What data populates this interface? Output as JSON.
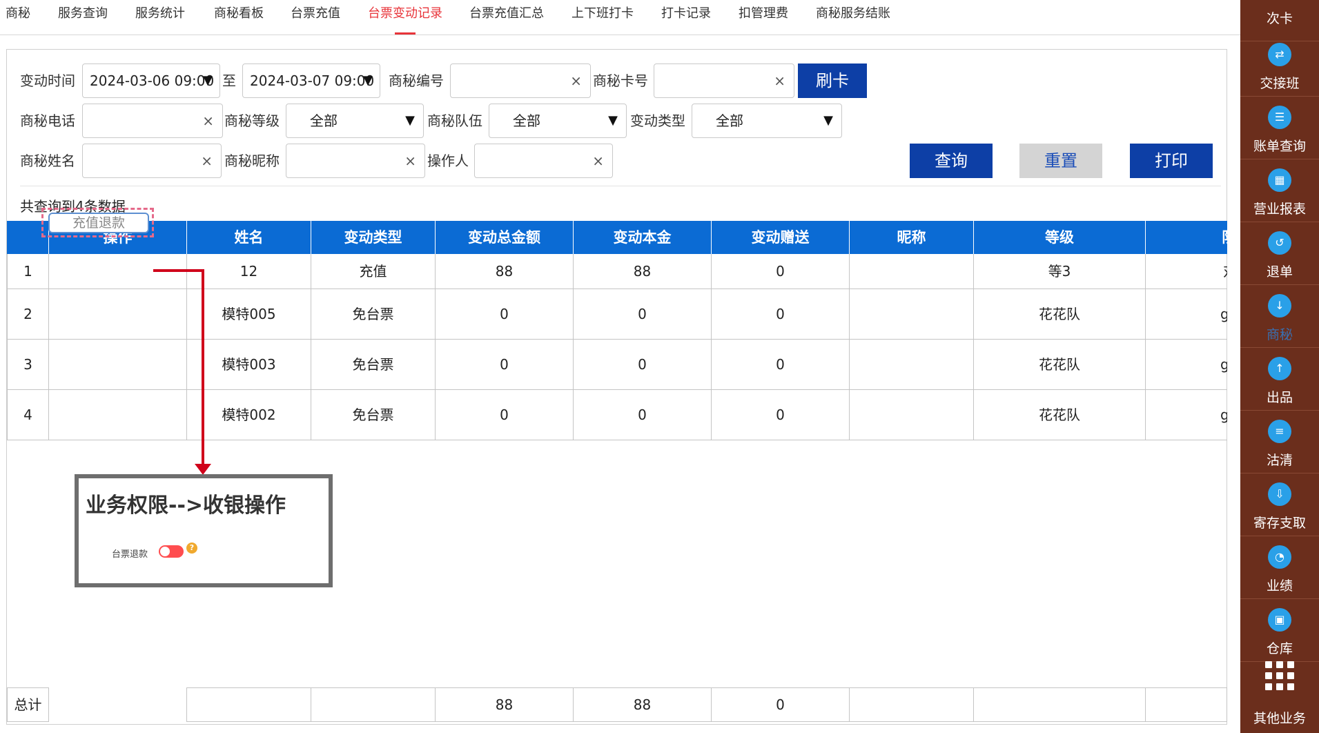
{
  "tabs": [
    {
      "label": "商秘",
      "active": false
    },
    {
      "label": "服务查询",
      "active": false
    },
    {
      "label": "服务统计",
      "active": false
    },
    {
      "label": "商秘看板",
      "active": false
    },
    {
      "label": "台票充值",
      "active": false
    },
    {
      "label": "台票变动记录",
      "active": true
    },
    {
      "label": "台票充值汇总",
      "active": false
    },
    {
      "label": "上下班打卡",
      "active": false
    },
    {
      "label": "打卡记录",
      "active": false
    },
    {
      "label": "扣管理费",
      "active": false
    },
    {
      "label": "商秘服务结账",
      "active": false
    }
  ],
  "filters": {
    "time_label": "变动时间",
    "start_time": "2024-03-06 09:00",
    "to_label": "至",
    "end_time": "2024-03-07 09:00",
    "dropdown_arrow": "▼",
    "code_label": "商秘编号",
    "card_label": "商秘卡号",
    "swipe_button": "刷卡",
    "phone_label": "商秘电话",
    "level_label": "商秘等级",
    "level_value": "全部",
    "team_label": "商秘队伍",
    "team_value": "全部",
    "type_label": "变动类型",
    "type_value": "全部",
    "name_label": "商秘姓名",
    "nickname_label": "商秘昵称",
    "operator_label": "操作人",
    "clear_symbol": "×",
    "query_button": "查询",
    "reset_button": "重置",
    "print_button": "打印"
  },
  "result_count_text": "共查询到4条数据",
  "table": {
    "headers": [
      "",
      "操作",
      "姓名",
      "变动类型",
      "变动总金额",
      "变动本金",
      "变动赠送",
      "昵称",
      "等级",
      "队"
    ],
    "action_button": "充值退款",
    "rows": [
      [
        "1",
        "",
        "12",
        "充值",
        "88",
        "88",
        "0",
        "",
        "等3",
        "对"
      ],
      [
        "2",
        "",
        "模特005",
        "免台票",
        "0",
        "0",
        "0",
        "",
        "花花队",
        "g("
      ],
      [
        "3",
        "",
        "模特003",
        "免台票",
        "0",
        "0",
        "0",
        "",
        "花花队",
        "g("
      ],
      [
        "4",
        "",
        "模特002",
        "免台票",
        "0",
        "0",
        "0",
        "",
        "花花队",
        "g("
      ]
    ],
    "footer": [
      "总计",
      "",
      "",
      "",
      "88",
      "88",
      "0",
      "",
      "",
      ""
    ]
  },
  "annotation": {
    "title": "业务权限-->收银操作",
    "setting_label": "台票退款",
    "help_symbol": "?"
  },
  "sidebar": {
    "items": [
      {
        "label": "次卡",
        "icon": "card-icon"
      },
      {
        "label": "交接班",
        "icon": "shift-icon"
      },
      {
        "label": "账单查询",
        "icon": "bill-search-icon"
      },
      {
        "label": "营业报表",
        "icon": "report-icon"
      },
      {
        "label": "退单",
        "icon": "refund-icon"
      },
      {
        "label": "商秘",
        "icon": "download-icon"
      },
      {
        "label": "出品",
        "icon": "upload-icon"
      },
      {
        "label": "沽清",
        "icon": "list-icon"
      },
      {
        "label": "寄存支取",
        "icon": "storage-icon"
      },
      {
        "label": "业绩",
        "icon": "pie-icon"
      },
      {
        "label": "仓库",
        "icon": "warehouse-icon"
      },
      {
        "label": "其他业务",
        "icon": "grid-icon"
      }
    ]
  },
  "colors": {
    "accent_red": "#e8343a",
    "header_blue": "#0b6bd4",
    "button_blue": "#0d3fa6",
    "sidebar_brown": "#6b2e1c",
    "annotation_red": "#d0021b"
  }
}
